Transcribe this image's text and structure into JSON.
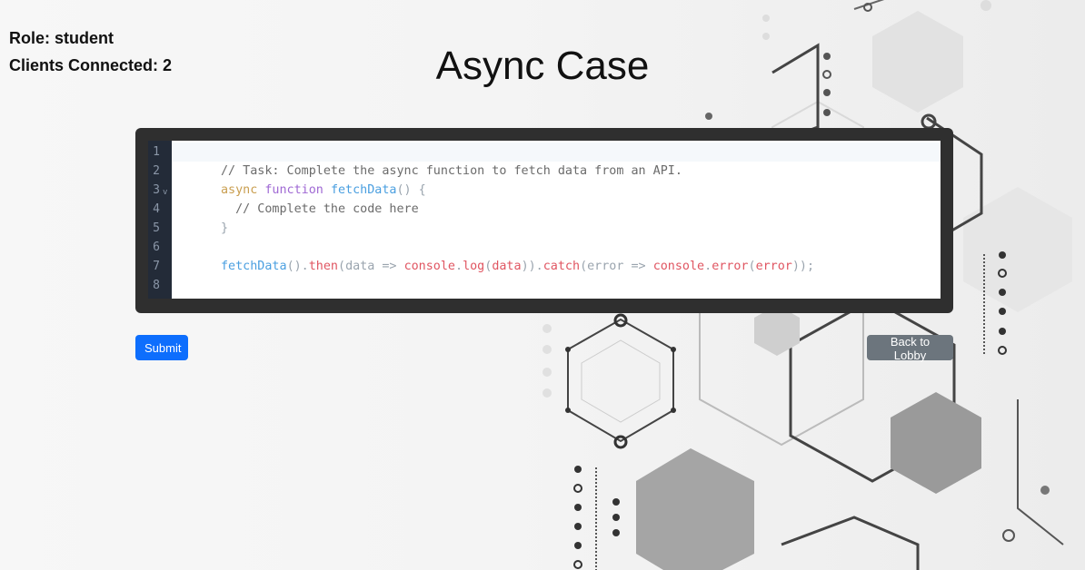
{
  "header": {
    "role_text": "Role: student",
    "clients_text": "Clients Connected: 2",
    "title": "Async Case"
  },
  "editor": {
    "line_numbers": [
      "1",
      "2",
      "3",
      "4",
      "5",
      "6",
      "7",
      "8"
    ],
    "fold_marker": "v",
    "lines": [
      [],
      [
        {
          "t": "// Task: Complete the async function to fetch data from an API.",
          "c": "c-comment"
        }
      ],
      [
        {
          "t": "async",
          "c": "c-async"
        },
        {
          "t": " ",
          "c": ""
        },
        {
          "t": "function",
          "c": "c-kw"
        },
        {
          "t": " ",
          "c": ""
        },
        {
          "t": "fetchData",
          "c": "c-fn"
        },
        {
          "t": "() {",
          "c": "c-punc"
        }
      ],
      [
        {
          "t": "  // Complete the code here",
          "c": "c-comment"
        }
      ],
      [
        {
          "t": "}",
          "c": "c-punc"
        }
      ],
      [],
      [
        {
          "t": "fetchData",
          "c": "c-fn"
        },
        {
          "t": "().",
          "c": "c-punc"
        },
        {
          "t": "then",
          "c": "c-red"
        },
        {
          "t": "(",
          "c": "c-punc"
        },
        {
          "t": "data",
          "c": "c-param"
        },
        {
          "t": " => ",
          "c": "c-arrow"
        },
        {
          "t": "console",
          "c": "c-red"
        },
        {
          "t": ".",
          "c": "c-punc"
        },
        {
          "t": "log",
          "c": "c-red"
        },
        {
          "t": "(",
          "c": "c-punc"
        },
        {
          "t": "data",
          "c": "c-red"
        },
        {
          "t": ")).",
          "c": "c-punc"
        },
        {
          "t": "catch",
          "c": "c-red"
        },
        {
          "t": "(",
          "c": "c-punc"
        },
        {
          "t": "error",
          "c": "c-param"
        },
        {
          "t": " => ",
          "c": "c-arrow"
        },
        {
          "t": "console",
          "c": "c-red"
        },
        {
          "t": ".",
          "c": "c-punc"
        },
        {
          "t": "error",
          "c": "c-red"
        },
        {
          "t": "(",
          "c": "c-punc"
        },
        {
          "t": "error",
          "c": "c-red"
        },
        {
          "t": "));",
          "c": "c-punc"
        }
      ],
      []
    ]
  },
  "buttons": {
    "submit_label": "Submit",
    "back_label": "Back to Lobby"
  },
  "colors": {
    "submit_bg": "#0d6efd",
    "back_bg": "#6c757d",
    "editor_frame": "#2f2f2f",
    "gutter": "#232b38"
  }
}
